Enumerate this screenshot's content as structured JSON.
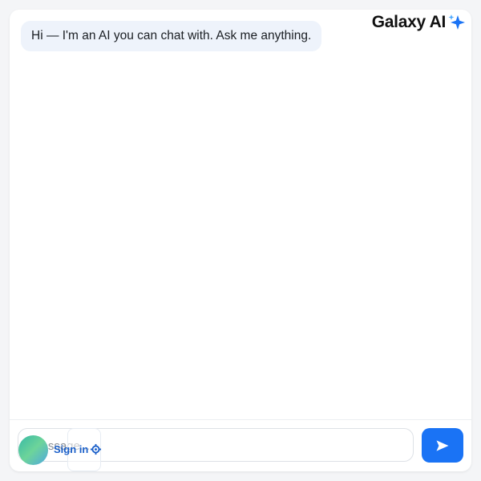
{
  "brand": {
    "name": "Galaxy AI",
    "icon": "sparkle-icon",
    "sparkle_color": "#1a73f5"
  },
  "chat": {
    "messages": [
      {
        "role": "assistant",
        "text": "Hi — I'm an AI you can chat with. Ask me anything."
      }
    ]
  },
  "composer": {
    "placeholder": "Message...",
    "value": ""
  },
  "send_button": {
    "icon": "send-icon",
    "color": "#1a73f5"
  },
  "account": {
    "sign_in_label": "Sign in",
    "avatar_icon": "avatar",
    "settings_icon": "gear-icon"
  }
}
